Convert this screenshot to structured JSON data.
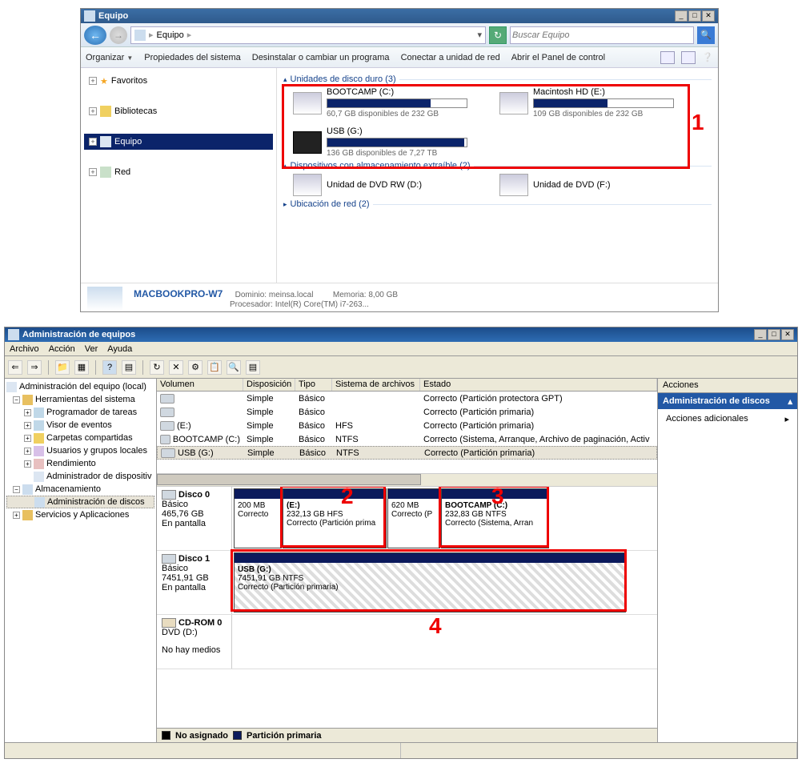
{
  "explorer": {
    "title": "Equipo",
    "breadcrumb": "Equipo",
    "search_placeholder": "Buscar Equipo",
    "cmdbar": {
      "organize": "Organizar",
      "sysprops": "Propiedades del sistema",
      "uninstall": "Desinstalar o cambiar un programa",
      "mapdrive": "Conectar a unidad de red",
      "controlpanel": "Abrir el Panel de control"
    },
    "tree": {
      "fav": "Favoritos",
      "lib": "Bibliotecas",
      "equipo": "Equipo",
      "red": "Red"
    },
    "sections": {
      "hdd": "Unidades de disco duro (3)",
      "removable": "Dispositivos con almacenamiento extraíble (2)",
      "network": "Ubicación de red (2)"
    },
    "drives": {
      "c_name": "BOOTCAMP (C:)",
      "c_free": "60,7 GB disponibles de 232 GB",
      "e_name": "Macintosh HD (E:)",
      "e_free": "109 GB disponibles de 232 GB",
      "g_name": "USB (G:)",
      "g_free": "136 GB disponibles de 7,27 TB",
      "dvd_rw": "Unidad de DVD RW (D:)",
      "dvd": "Unidad de DVD (F:)"
    },
    "status": {
      "pcname": "MACBOOKPRO-W7",
      "domain_label": "Dominio:",
      "domain": "meinsa.local",
      "mem_label": "Memoria:",
      "mem": "8,00 GB",
      "proc_label": "Procesador:",
      "proc": "Intel(R) Core(TM) i7-263..."
    }
  },
  "mgmt": {
    "title": "Administración de equipos",
    "menu": {
      "archivo": "Archivo",
      "accion": "Acción",
      "ver": "Ver",
      "ayuda": "Ayuda"
    },
    "tree": {
      "root": "Administración del equipo (local)",
      "sys": "Herramientas del sistema",
      "task": "Programador de tareas",
      "event": "Visor de eventos",
      "shared": "Carpetas compartidas",
      "users": "Usuarios y grupos locales",
      "perf": "Rendimiento",
      "devmgr": "Administrador de dispositiv",
      "storage": "Almacenamiento",
      "diskmgmt": "Administración de discos",
      "services": "Servicios y Aplicaciones"
    },
    "vol_headers": {
      "vol": "Volumen",
      "disp": "Disposición",
      "tipo": "Tipo",
      "fs": "Sistema de archivos",
      "estado": "Estado"
    },
    "volumes": [
      {
        "name": "",
        "disp": "Simple",
        "tipo": "Básico",
        "fs": "",
        "stat": "Correcto (Partición protectora GPT)"
      },
      {
        "name": "",
        "disp": "Simple",
        "tipo": "Básico",
        "fs": "",
        "stat": "Correcto (Partición primaria)"
      },
      {
        "name": "(E:)",
        "disp": "Simple",
        "tipo": "Básico",
        "fs": "HFS",
        "stat": "Correcto (Partición primaria)"
      },
      {
        "name": "BOOTCAMP (C:)",
        "disp": "Simple",
        "tipo": "Básico",
        "fs": "NTFS",
        "stat": "Correcto (Sistema, Arranque, Archivo de paginación, Activ"
      },
      {
        "name": "USB (G:)",
        "disp": "Simple",
        "tipo": "Básico",
        "fs": "NTFS",
        "stat": "Correcto (Partición primaria)"
      }
    ],
    "disk0": {
      "header": "Disco 0",
      "type": "Básico",
      "size": "465,76 GB",
      "status": "En pantalla",
      "p0_size": "200 MB",
      "p0_stat": "Correcto",
      "p1_name": "(E:)",
      "p1_size": "232,13 GB HFS",
      "p1_stat": "Correcto (Partición prima",
      "p2_size": "620 MB",
      "p2_stat": "Correcto (P",
      "p3_name": "BOOTCAMP (C:)",
      "p3_size": "232,83 GB NTFS",
      "p3_stat": "Correcto (Sistema, Arran"
    },
    "disk1": {
      "header": "Disco 1",
      "type": "Básico",
      "size": "7451,91 GB",
      "status": "En pantalla",
      "p0_name": "USB (G:)",
      "p0_size": "7451,91 GB NTFS",
      "p0_stat": "Correcto (Partición primaria)"
    },
    "cdrom": {
      "header": "CD-ROM 0",
      "type": "DVD (D:)",
      "status": "No hay medios"
    },
    "legend": {
      "unalloc": "No asignado",
      "primary": "Partición primaria"
    },
    "actions": {
      "hdr": "Acciones",
      "diskmgmt": "Administración de discos",
      "more": "Acciones adicionales"
    }
  },
  "annotations": {
    "a1": "1",
    "a2": "2",
    "a3": "3",
    "a4": "4"
  }
}
